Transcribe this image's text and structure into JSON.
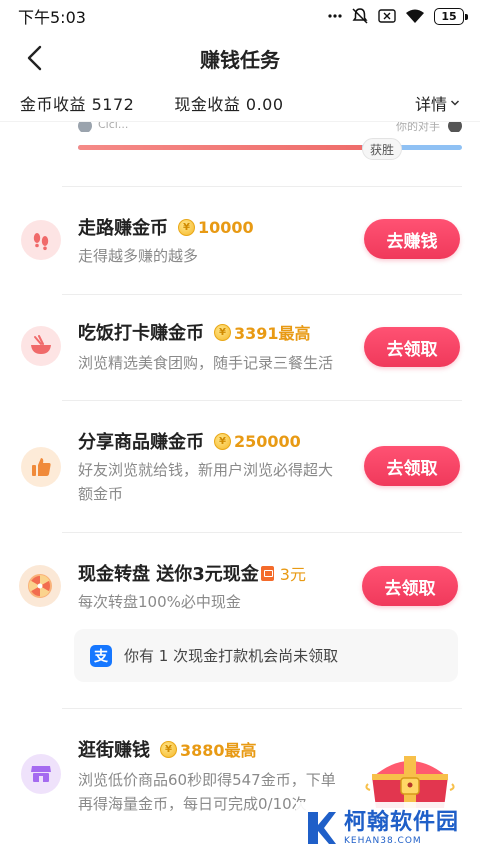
{
  "status_bar": {
    "time": "下午5:03",
    "battery": "15"
  },
  "nav": {
    "title": "赚钱任务"
  },
  "earnings": {
    "coin_label": "金币收益 5172",
    "cash_label": "现金收益 0.00",
    "details_label": "详情"
  },
  "challenge": {
    "left_name": "Cici...",
    "right_name": "你的对手",
    "win_label": "获胜",
    "left_progress": 0.74
  },
  "tasks": [
    {
      "title": "走路赚金币",
      "coin_symbol": "¥",
      "reward": "10000",
      "desc_lines": [
        "走得越多赚的越多"
      ],
      "button": "去赚钱",
      "icon": "footprints-icon"
    },
    {
      "title": "吃饭打卡赚金币",
      "coin_symbol": "¥",
      "reward": "3391最高",
      "desc_lines": [
        "浏览精选美食团购，随手记录三餐生活"
      ],
      "button": "去领取",
      "icon": "bowl-icon"
    },
    {
      "title": "分享商品赚金币",
      "coin_symbol": "¥",
      "reward": "250000",
      "desc_lines": [
        "好友浏览就给钱，新用户浏览必得超大",
        "额金币"
      ],
      "button": "去领取",
      "icon": "thumbs-up-icon"
    },
    {
      "title": "现金转盘 送你3元现金",
      "reward": "3元",
      "desc_lines": [
        "每次转盘100%必中现金"
      ],
      "button": "去领取",
      "icon": "wheel-icon"
    },
    {
      "title": "逛街赚钱",
      "coin_symbol": "¥",
      "reward": "3880最高",
      "desc_lines": [
        "浏览低价商品60秒即得547金币，下单",
        "再得海量金币，每日可完成0/10次"
      ],
      "icon": "shop-icon"
    }
  ],
  "notice": {
    "icon_text": "支",
    "text": "你有 1 次现金打款机会尚未领取"
  },
  "watermark": {
    "name": "柯翰软件园",
    "url": "KEHAN38.COM"
  },
  "colors": {
    "accent": "#f0395b",
    "reward": "#e89a14",
    "progress_left": "#ef6d6b",
    "progress_right": "#8fc1f4"
  }
}
